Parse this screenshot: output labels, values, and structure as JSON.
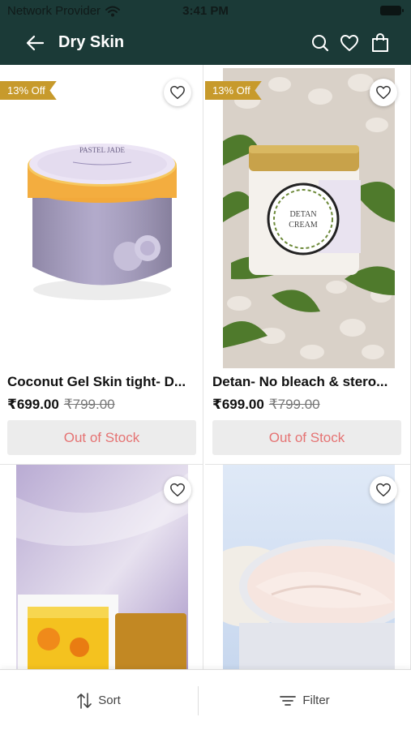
{
  "status_bar": {
    "carrier": "Network Provider",
    "time": "3:41 PM"
  },
  "header": {
    "title": "Dry Skin"
  },
  "products": [
    {
      "name": "Coconut Gel Skin tight- D...",
      "price": "₹699.00",
      "old_price": "₹799.00",
      "discount": "13% Off",
      "stock": "Out of Stock",
      "jar_label_title": "PASTEL JADE"
    },
    {
      "name": "Detan- No bleach & stero...",
      "price": "₹699.00",
      "old_price": "₹799.00",
      "discount": "13% Off",
      "stock": "Out of Stock",
      "jar_label_title": "DETAN CREAM"
    }
  ],
  "bottom_bar": {
    "sort_label": "Sort",
    "filter_label": "Filter"
  },
  "colors": {
    "header_bg": "#1b3a37",
    "badge": "#c79a2c",
    "out_of_stock_text": "#e57373"
  }
}
